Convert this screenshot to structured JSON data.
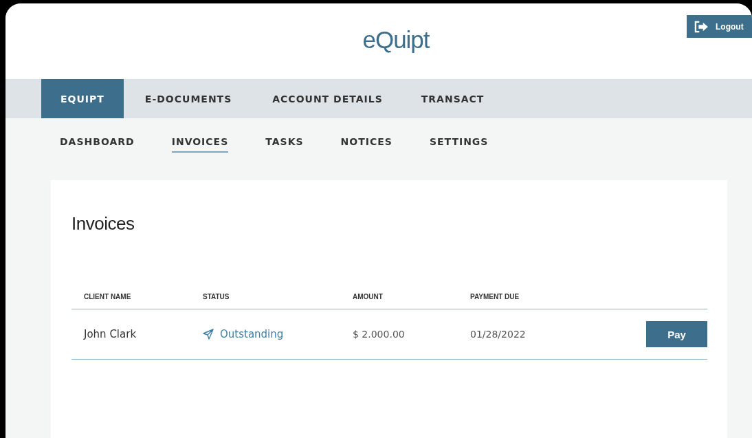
{
  "header": {
    "logo": "eQuipt",
    "logout": "Logout"
  },
  "main_nav": [
    {
      "label": "EQUIPT",
      "selected": true
    },
    {
      "label": "E-DOCUMENTS",
      "selected": false
    },
    {
      "label": "ACCOUNT DETAILS",
      "selected": false
    },
    {
      "label": "TRANSACT",
      "selected": false
    }
  ],
  "sub_nav": [
    {
      "label": "DASHBOARD",
      "selected": false
    },
    {
      "label": "INVOICES",
      "selected": true
    },
    {
      "label": "TASKS",
      "selected": false
    },
    {
      "label": "NOTICES",
      "selected": false
    },
    {
      "label": "SETTINGS",
      "selected": false
    }
  ],
  "page_title": "Invoices",
  "table": {
    "columns": [
      "CLIENT NAME",
      "STATUS",
      "AMOUNT",
      "PAYMENT DUE"
    ],
    "rows": [
      {
        "client": "John Clark",
        "status": "Outstanding",
        "amount": "$ 2.000.00",
        "due": "01/28/2022",
        "action": "Pay"
      }
    ]
  }
}
